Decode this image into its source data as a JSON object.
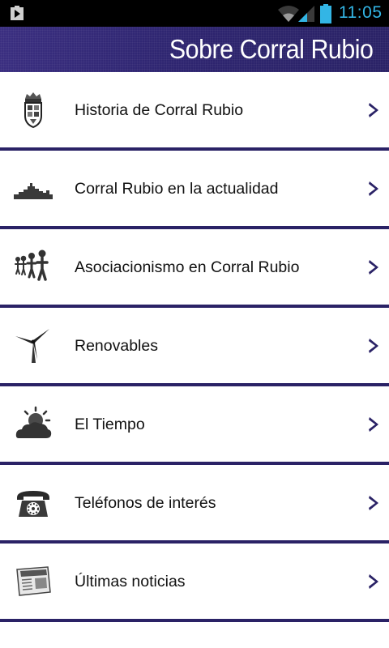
{
  "status_bar": {
    "time": "11:05",
    "time_color": "#33b5e5",
    "icons": [
      "play-store-icon",
      "wifi-icon",
      "signal-icon",
      "battery-icon"
    ]
  },
  "header": {
    "title": "Sobre Corral Rubio",
    "background": "#2e2570"
  },
  "menu": {
    "divider_color": "#2a2266",
    "items": [
      {
        "label": "Historia de Corral Rubio",
        "icon": "coat-of-arms-icon"
      },
      {
        "label": "Corral Rubio en la actualidad",
        "icon": "town-skyline-icon"
      },
      {
        "label": "Asociacionismo en Corral Rubio",
        "icon": "people-icon"
      },
      {
        "label": "Renovables",
        "icon": "wind-turbine-icon"
      },
      {
        "label": "El Tiempo",
        "icon": "weather-icon"
      },
      {
        "label": "Teléfonos de interés",
        "icon": "telephone-icon"
      },
      {
        "label": "Últimas noticias",
        "icon": "newspaper-icon"
      }
    ]
  }
}
